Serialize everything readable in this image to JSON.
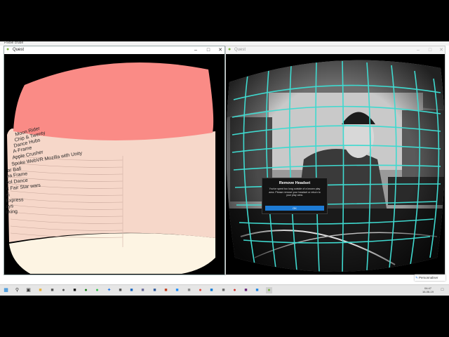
{
  "screen_top_text": "Pillole crude",
  "left_window": {
    "title": "Quest",
    "menu_items": [
      "Moon Rider",
      "Chip & Twenty",
      "Dance Hubs",
      "A-Frame",
      "Apple Crusher",
      "Spoke WebVR Mozilla with Unity",
      "ar Ball",
      "na Frame",
      "ool Dance",
      "rt Fair Star wars",
      "ni",
      "Express",
      "ays",
      "oking"
    ]
  },
  "right_window": {
    "title": "Quest"
  },
  "dialog": {
    "title": "Remove Headset",
    "body": "You've spent too long outside of a known play area. Please remove your headset or return to your play area.",
    "button_label": "OK"
  },
  "promo": {
    "label": "Personnaliser"
  },
  "window_controls": {
    "minimize": "–",
    "maximize": "□",
    "close": "✕"
  },
  "taskbar": {
    "time": "04:47",
    "date": "16-06-19",
    "icons": [
      "windows-start-icon",
      "search-icon",
      "task-view-icon",
      "file-explorer-icon",
      "store-icon",
      "app-icon",
      "app-icon",
      "xbox-icon",
      "app-icon",
      "app-icon",
      "app-icon",
      "app-icon",
      "app-icon",
      "word-icon",
      "excel-icon",
      "app-icon",
      "app-icon",
      "chrome-icon",
      "app-icon",
      "app-icon",
      "app-icon",
      "visual-studio-icon",
      "app-icon",
      "android-icon"
    ],
    "active_index": 23
  },
  "colors": {
    "dome_red": "#fa8b86",
    "menu_panel": "#f6d7c9",
    "floor": "#fdf4e3",
    "boundary_grid": "#3fd9cf",
    "dialog_button": "#1e7bd4"
  }
}
